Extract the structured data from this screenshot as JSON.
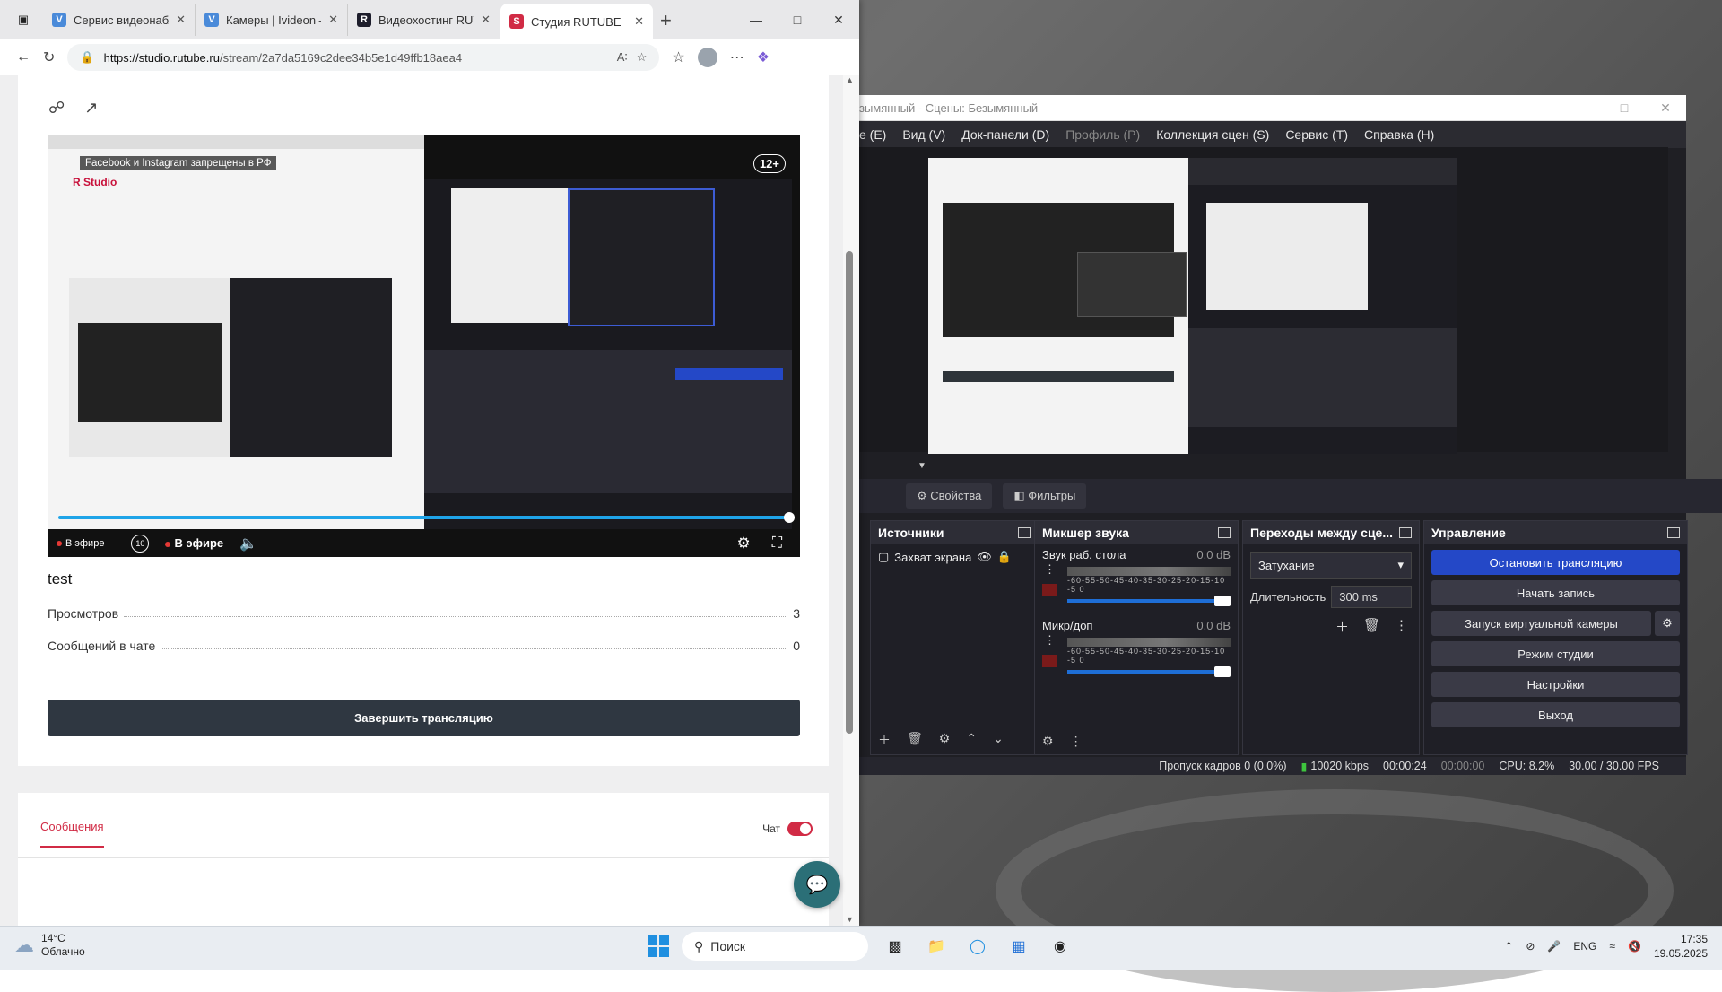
{
  "browser": {
    "tabs": [
      {
        "label": "Сервис видеонаблю",
        "favicon": "V",
        "color": "#4a8ad9"
      },
      {
        "label": "Камеры | Ivideon — ",
        "favicon": "V",
        "color": "#4a8ad9"
      },
      {
        "label": "Видеохостинг RUTU",
        "favicon": "R",
        "color": "#1e1e2c"
      },
      {
        "label": "Студия RUTUBE",
        "favicon": "S",
        "color": "#d12b45"
      }
    ],
    "url_host": "https://studio.rutube.ru",
    "url_path": "/stream/2a7da5169c2dee34b5e1d49ffb18aea4"
  },
  "player": {
    "fb_note": "Facebook и Instagram запрещены в РФ",
    "age": "12+",
    "live_left": "В эфире",
    "live_center": "В эфире",
    "rewind": "10",
    "progress": 1.0,
    "inner_logo": "R Studio"
  },
  "stream": {
    "title": "test",
    "stats": [
      {
        "label": "Просмотров",
        "value": "3"
      },
      {
        "label": "Сообщений в чате",
        "value": "0"
      }
    ],
    "end_button": "Завершить трансляцию"
  },
  "chat": {
    "tab": "Сообщения",
    "toggle_label": "Чат",
    "toggle_on": true
  },
  "obs": {
    "title": "зымянный - Сцены: Безымянный",
    "menu": [
      {
        "label": "е (Е)",
        "dim": false
      },
      {
        "label": "Вид (V)",
        "dim": false
      },
      {
        "label": "Док-панели (D)",
        "dim": false
      },
      {
        "label": "Профиль (Р)",
        "dim": true
      },
      {
        "label": "Коллекция сцен (S)",
        "dim": false
      },
      {
        "label": "Сервис (Т)",
        "dim": false
      },
      {
        "label": "Справка (Н)",
        "dim": false
      }
    ],
    "props_btn": "Свойства",
    "filters_btn": "Фильтры",
    "sources": {
      "title": "Источники",
      "items": [
        "Захват экрана"
      ]
    },
    "mixer": {
      "title": "Микшер звука",
      "channels": [
        {
          "name": "Звук раб. стола",
          "db": "0.0 dB"
        },
        {
          "name": "Микр/доп",
          "db": "0.0 dB"
        }
      ],
      "scale": "-60-55-50-45-40-35-30-25-20-15-10 -5 0"
    },
    "transitions": {
      "title": "Переходы между сце...",
      "selected": "Затухание",
      "duration_label": "Длительность",
      "duration": "300 ms"
    },
    "controls": {
      "title": "Управление",
      "buttons": [
        "Остановить трансляцию",
        "Начать запись",
        "Запуск виртуальной камеры",
        "Режим студии",
        "Настройки",
        "Выход"
      ]
    },
    "status": {
      "dropped": "Пропуск кадров 0 (0.0%)",
      "bitrate": "10020 kbps",
      "stream_time": "00:00:24",
      "rec_time": "00:00:00",
      "cpu": "CPU: 8.2%",
      "fps": "30.00 / 30.00 FPS"
    }
  },
  "taskbar": {
    "weather_temp": "14°C",
    "weather_desc": "Облачно",
    "search": "Поиск",
    "lang": "ENG",
    "time": "17:35",
    "date": "19.05.2025"
  }
}
